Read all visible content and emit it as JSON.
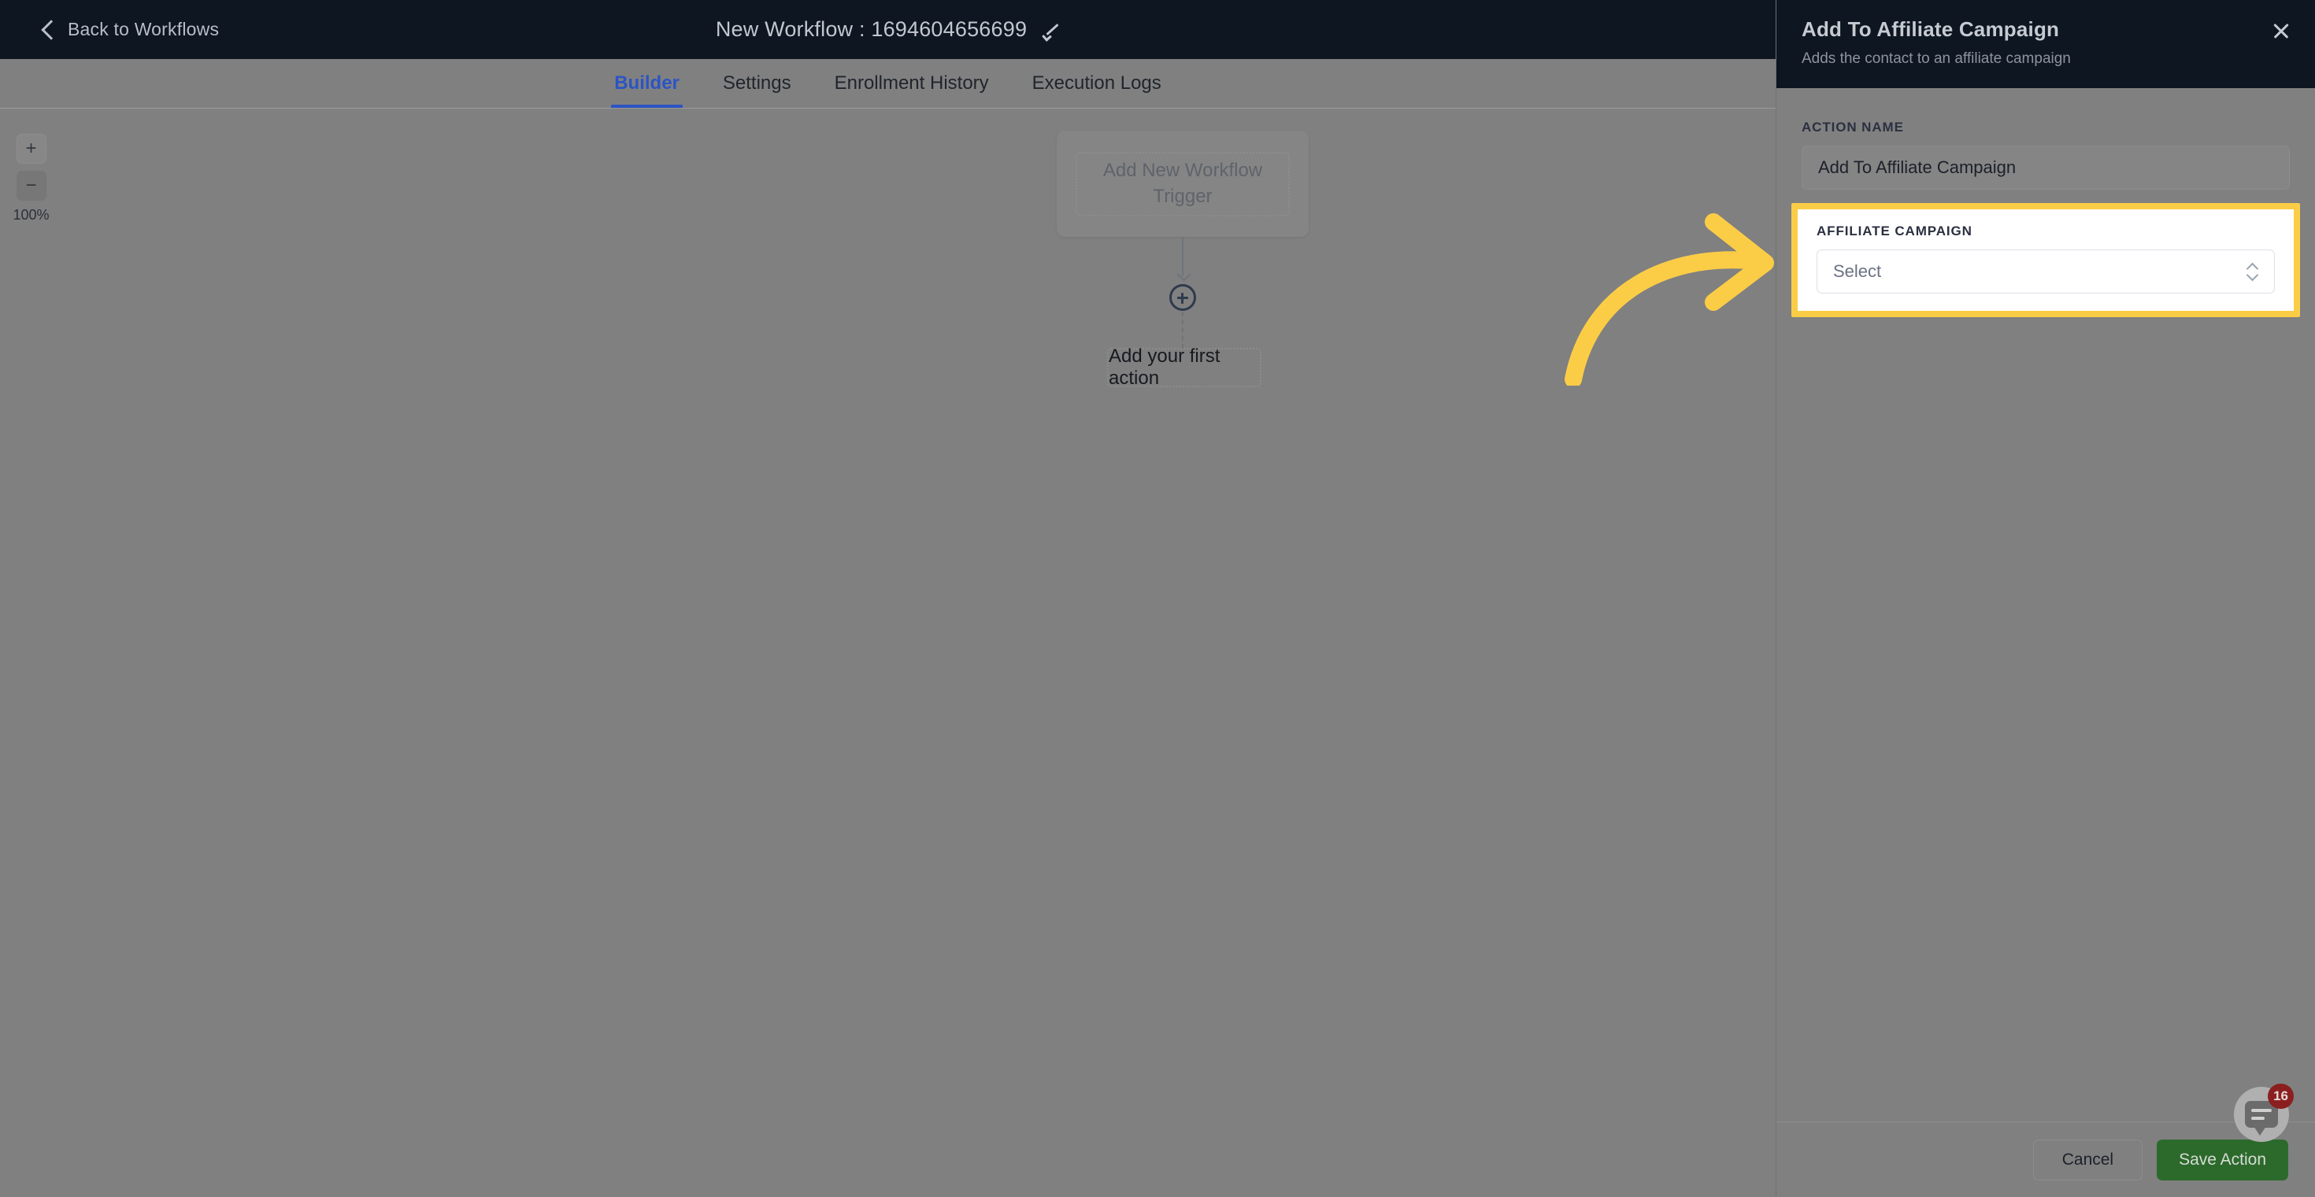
{
  "topbar": {
    "back_label": "Back to Workflows",
    "back_icon": "chevron-left-icon",
    "workflow_title": "New Workflow : 1694604656699",
    "edit_icon": "pencil-icon"
  },
  "tabs": [
    {
      "label": "Builder",
      "active": true
    },
    {
      "label": "Settings",
      "active": false
    },
    {
      "label": "Enrollment History",
      "active": false
    },
    {
      "label": "Execution Logs",
      "active": false
    }
  ],
  "zoom_controls": {
    "zoom_in_label": "+",
    "zoom_out_label": "−",
    "zoom_level": "100%"
  },
  "canvas": {
    "trigger_card_label": "Add New Workflow Trigger",
    "add_node_icon": "plus-circle-icon",
    "first_action_label": "Add your first action"
  },
  "panel": {
    "title": "Add To Affiliate Campaign",
    "subtitle": "Adds the contact to an affiliate campaign",
    "close_icon": "close-icon",
    "action_name": {
      "label": "ACTION NAME",
      "value": "Add To Affiliate Campaign"
    },
    "affiliate_campaign": {
      "label": "AFFILIATE CAMPAIGN",
      "value": "Select",
      "stepper_icon": "chevron-up-down-icon"
    },
    "footer": {
      "cancel_label": "Cancel",
      "save_label": "Save Action"
    }
  },
  "chat_widget": {
    "icon": "chat-bubble-icon",
    "badge_count": "16"
  },
  "annotation": {
    "arrow_icon": "curved-arrow-right-icon",
    "highlight_color": "#fbcd46"
  },
  "colors": {
    "header_bg": "#0e1622",
    "accent_blue": "#2c54c4",
    "save_green": "#2c6a2c",
    "badge_red": "#8b1f1f",
    "highlight_yellow": "#fbcd46"
  }
}
